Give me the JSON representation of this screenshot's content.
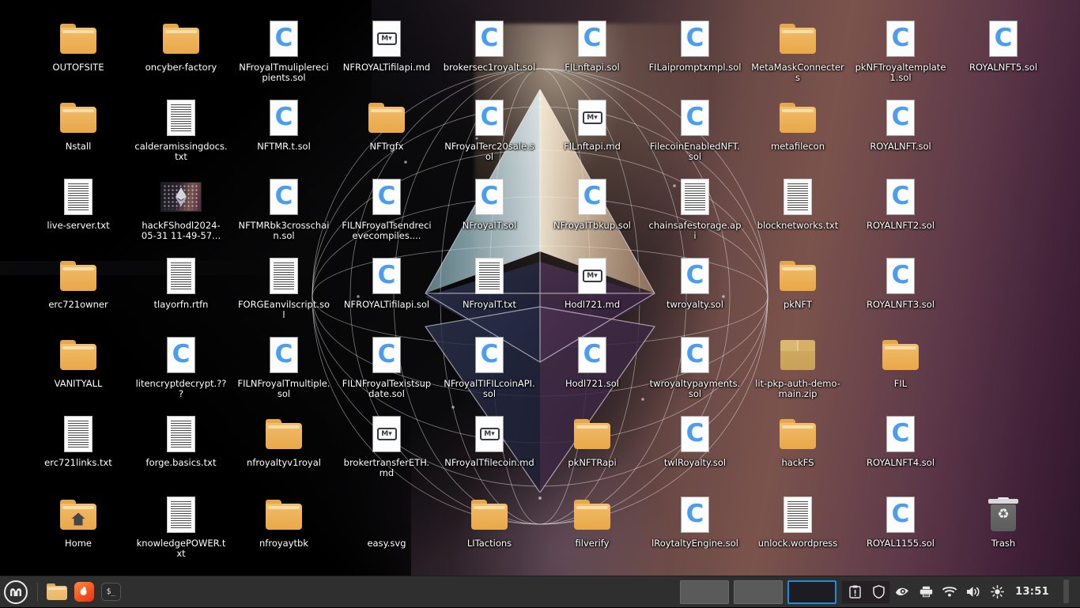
{
  "desktop": {
    "wallpaper_description": "ethereum-wireframe-globe",
    "colors": {
      "panel_bg": "#2f2f2f",
      "accent_blue": "#1e8fd6",
      "folder": "#eeb45e",
      "solidity_blue": "#4a9df0",
      "label_text": "#ffffff"
    },
    "icons": [
      {
        "label": "OUTOFSITE",
        "type": "folder"
      },
      {
        "label": "oncyber-factory",
        "type": "folder"
      },
      {
        "label": "NFroyalTmuliplerecipients.sol",
        "type": "sol"
      },
      {
        "label": "NFROYALTifilapi.md",
        "type": "md"
      },
      {
        "label": "brokersec1royalt.sol",
        "type": "sol"
      },
      {
        "label": "FILnftapi.sol",
        "type": "sol"
      },
      {
        "label": "FILaipromptxmpl.sol",
        "type": "sol"
      },
      {
        "label": "MetaMaskConnecters",
        "type": "folder"
      },
      {
        "label": "pkNFTroyaltemplate1.sol",
        "type": "sol"
      },
      {
        "label": "ROYALNFT5.sol",
        "type": "sol"
      },
      {
        "label": "Nstall",
        "type": "folder"
      },
      {
        "label": "calderamissingdocs.txt",
        "type": "doc"
      },
      {
        "label": "NFTMR.t.sol",
        "type": "sol"
      },
      {
        "label": "NFTrgfx",
        "type": "folder"
      },
      {
        "label": "NFroyalTerc20sale.sol",
        "type": "sol"
      },
      {
        "label": "FILnftapi.md",
        "type": "md"
      },
      {
        "label": "FilecoinEnabledNFT.sol",
        "type": "sol"
      },
      {
        "label": "metafilecon",
        "type": "folder"
      },
      {
        "label": "ROYALNFT.sol",
        "type": "sol"
      },
      {
        "label": "live-server.txt",
        "type": "doc"
      },
      {
        "label": "hackFShodl2024-05-31 11-49-57...",
        "type": "image"
      },
      {
        "label": "NFTMRbk3crosschain.sol",
        "type": "sol"
      },
      {
        "label": "FILNFroyalTsendrecievecompiles....",
        "type": "sol"
      },
      {
        "label": "NFroyalT.sol",
        "type": "sol"
      },
      {
        "label": "NFroyalTbkup.sol",
        "type": "sol"
      },
      {
        "label": "chainsafestorage.api",
        "type": "doc"
      },
      {
        "label": "blocknetworks.txt",
        "type": "doc"
      },
      {
        "label": "ROYALNFT2.sol",
        "type": "sol"
      },
      {
        "label": "erc721owner",
        "type": "folder"
      },
      {
        "label": "tlayorfn.rtfn",
        "type": "doc"
      },
      {
        "label": "FORGEanvilscript.sol",
        "type": "doc"
      },
      {
        "label": "NFROYALTifilapi.sol",
        "type": "sol"
      },
      {
        "label": "NFroyalT.txt",
        "type": "doc"
      },
      {
        "label": "Hodl721.md",
        "type": "md"
      },
      {
        "label": "twroyalty.sol",
        "type": "sol"
      },
      {
        "label": "pkNFT",
        "type": "folder"
      },
      {
        "label": "ROYALNFT3.sol",
        "type": "sol"
      },
      {
        "label": "VANITYALL",
        "type": "folder"
      },
      {
        "label": "litencryptdecrypt.???",
        "type": "sol"
      },
      {
        "label": "FILNFroyalTmultiple.sol",
        "type": "sol"
      },
      {
        "label": "FILNFroyalTexistsupdate.sol",
        "type": "sol"
      },
      {
        "label": "NFroyalTIFILcoinAPI.sol",
        "type": "sol"
      },
      {
        "label": "Hodl721.sol",
        "type": "sol"
      },
      {
        "label": "twroyaltypayments.sol",
        "type": "sol"
      },
      {
        "label": "lit-pkp-auth-demo-main.zip",
        "type": "zip"
      },
      {
        "label": "FIL",
        "type": "folder"
      },
      {
        "label": "erc721links.txt",
        "type": "doc"
      },
      {
        "label": "forge.basics.txt",
        "type": "doc"
      },
      {
        "label": "nfroyaltyv1royal",
        "type": "folder"
      },
      {
        "label": "brokertransferETH.md",
        "type": "md"
      },
      {
        "label": "NFroyalTfilecoin.md",
        "type": "md"
      },
      {
        "label": "pkNFTRapi",
        "type": "folder"
      },
      {
        "label": "twlRoyalty.sol",
        "type": "sol"
      },
      {
        "label": "hackFS",
        "type": "folder"
      },
      {
        "label": "ROYALNFT4.sol",
        "type": "sol"
      },
      {
        "label": "Home",
        "type": "home"
      },
      {
        "label": "knowledgePOWER.txt",
        "type": "doc"
      },
      {
        "label": "nfroyaytbk",
        "type": "folder"
      },
      {
        "label": "easy.svg",
        "type": "svg"
      },
      {
        "label": "LITactions",
        "type": "folder"
      },
      {
        "label": "filverify",
        "type": "folder"
      },
      {
        "label": "lRoytaltyEngine.sol",
        "type": "sol"
      },
      {
        "label": "unlock.wordpress",
        "type": "doc"
      },
      {
        "label": "ROYAL1155.sol",
        "type": "sol"
      },
      {
        "label": "Trash",
        "type": "trash"
      }
    ]
  },
  "panel": {
    "menu_button_label": "Menu",
    "launchers": [
      {
        "name": "files",
        "tooltip": "Files"
      },
      {
        "name": "firefox",
        "tooltip": "Firefox Web Browser"
      },
      {
        "name": "terminal",
        "tooltip": "Terminal"
      }
    ],
    "workspaces": [
      {
        "name": "workspace-1",
        "active": false
      },
      {
        "name": "workspace-2",
        "active": false
      },
      {
        "name": "workspace-3",
        "active": true
      },
      {
        "name": "workspace-4",
        "active": false
      }
    ],
    "tray": [
      {
        "name": "update-manager-icon"
      },
      {
        "name": "firewall-shield-icon"
      },
      {
        "name": "nvidia-icon"
      },
      {
        "name": "printer-icon"
      },
      {
        "name": "network-wifi-icon"
      },
      {
        "name": "volume-icon"
      },
      {
        "name": "brightness-icon"
      }
    ],
    "clock": "13:51"
  }
}
